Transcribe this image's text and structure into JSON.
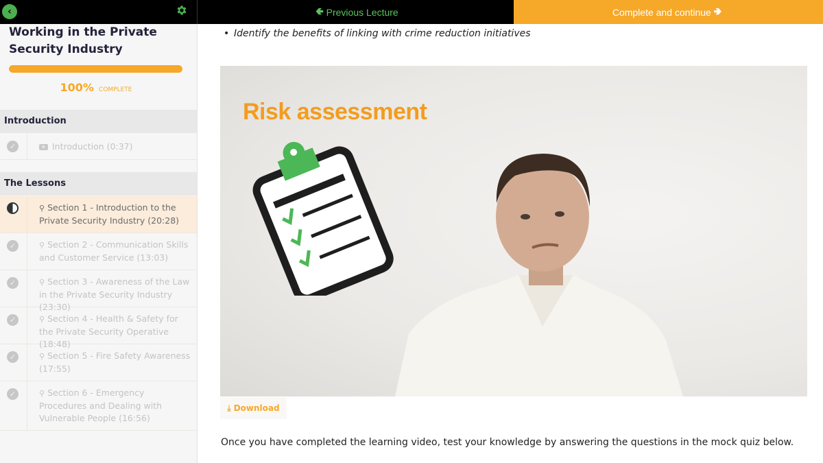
{
  "topbar": {
    "back_icon": "chevron-left-icon",
    "settings_icon": "gear-icon",
    "prev_label": "Previous Lecture",
    "next_label": "Complete and continue",
    "accent_color": "#f6a828",
    "green_color": "#4caf50"
  },
  "sidebar": {
    "course_title": "Working in the Private Security Industry",
    "progress_percent": 100,
    "progress_num": "100%",
    "progress_label": "COMPLETE",
    "sections": [
      {
        "title": "Introduction",
        "lessons": [
          {
            "label": "Introduction (0:37)",
            "type": "video",
            "status": "complete"
          }
        ]
      },
      {
        "title": "The Lessons",
        "lessons": [
          {
            "label": "Section 1 - Introduction to the Private Security Industry (20:28)",
            "type": "lesson",
            "status": "in-progress"
          },
          {
            "label": "Section 2 - Communication Skills and Customer Service (13:03)",
            "type": "lesson",
            "status": "complete"
          },
          {
            "label": "Section 3 - Awareness of the Law in the Private Security Industry (23:30)",
            "type": "lesson",
            "status": "complete"
          },
          {
            "label": "Section 4 - Health & Safety for the Private Security Operative (18:48)",
            "type": "lesson",
            "status": "complete"
          },
          {
            "label": "Section 5 - Fire Safety Awareness (17:55)",
            "type": "lesson",
            "status": "complete"
          },
          {
            "label": "Section 6 - Emergency Procedures and Dealing with Vulnerable People (16:56)",
            "type": "lesson",
            "status": "complete"
          }
        ]
      }
    ]
  },
  "main": {
    "bullet_text": "Identify the benefits of linking with crime reduction initiatives",
    "video": {
      "slide_title": "Risk assessment"
    },
    "download_label": "Download",
    "paragraph": "Once you have completed the learning video, test your knowledge by answering the questions in the mock quiz below."
  }
}
